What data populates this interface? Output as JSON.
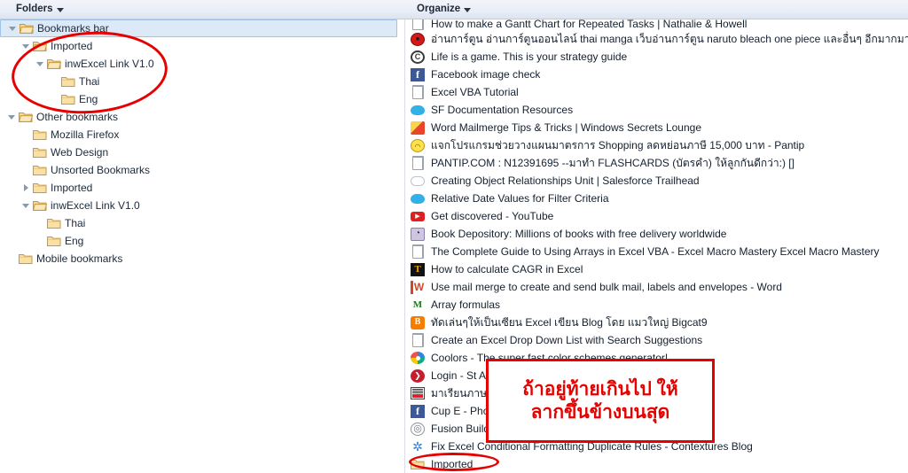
{
  "toolbar": {
    "folders_label": "Folders",
    "organize_label": "Organize"
  },
  "tree": {
    "items": [
      {
        "label": "Bookmarks bar",
        "depth": 0,
        "twisty": "open",
        "icon": "folder-open",
        "selected": true
      },
      {
        "label": "Imported",
        "depth": 1,
        "twisty": "open",
        "icon": "folder-open",
        "selected": false
      },
      {
        "label": "inwExcel Link V1.0",
        "depth": 2,
        "twisty": "open",
        "icon": "folder-open",
        "selected": false
      },
      {
        "label": "Thai",
        "depth": 3,
        "twisty": "none",
        "icon": "folder",
        "selected": false
      },
      {
        "label": "Eng",
        "depth": 3,
        "twisty": "none",
        "icon": "folder",
        "selected": false
      },
      {
        "label": "Other bookmarks",
        "depth": 0,
        "twisty": "open",
        "icon": "folder-open",
        "selected": false
      },
      {
        "label": "Mozilla Firefox",
        "depth": 1,
        "twisty": "none",
        "icon": "folder",
        "selected": false
      },
      {
        "label": "Web Design",
        "depth": 1,
        "twisty": "none",
        "icon": "folder",
        "selected": false
      },
      {
        "label": "Unsorted Bookmarks",
        "depth": 1,
        "twisty": "none",
        "icon": "folder",
        "selected": false
      },
      {
        "label": "Imported",
        "depth": 1,
        "twisty": "closed",
        "icon": "folder",
        "selected": false
      },
      {
        "label": "inwExcel Link V1.0",
        "depth": 1,
        "twisty": "open",
        "icon": "folder-open",
        "selected": false
      },
      {
        "label": "Thai",
        "depth": 2,
        "twisty": "none",
        "icon": "folder",
        "selected": false
      },
      {
        "label": "Eng",
        "depth": 2,
        "twisty": "none",
        "icon": "folder",
        "selected": false
      },
      {
        "label": "Mobile bookmarks",
        "depth": 0,
        "twisty": "none",
        "icon": "folder",
        "selected": false
      }
    ]
  },
  "list": {
    "items": [
      {
        "label": "How to make a Gantt Chart for Repeated Tasks | Nathalie & Howell",
        "icon": "document-icon",
        "icon_class": "fv-doc",
        "clipped": true
      },
      {
        "label": "อ่านการ์ตูน อ่านการ์ตูนออนไลน์ thai manga เว็บอ่านการ์ตูน naruto bleach one piece และอื่นๆ อีกมากมาย",
        "icon": "sharingan-icon",
        "icon_class": "fv-sharingan"
      },
      {
        "label": "Life is a game. This is your strategy guide",
        "icon": "copyright-icon",
        "icon_class": "fv-copy",
        "glyph": "C"
      },
      {
        "label": "Facebook image check",
        "icon": "facebook-icon",
        "icon_class": "fv-fb",
        "glyph": "f"
      },
      {
        "label": "Excel VBA Tutorial",
        "icon": "document-icon",
        "icon_class": "fv-doc"
      },
      {
        "label": "SF Documentation Resources",
        "icon": "salesforce-cloud-icon",
        "icon_class": "fv-cloud"
      },
      {
        "label": "Word Mailmerge Tips & Tricks | Windows Secrets Lounge",
        "icon": "windows-secrets-icon",
        "icon_class": "fv-wsl"
      },
      {
        "label": "แจกโปรแกรมช่วยวางแผนมาตรการ Shopping ลดหย่อนภาษี 15,000 บาท - Pantip",
        "icon": "pantip-icon",
        "icon_class": "fv-pantip"
      },
      {
        "label": "PANTIP.COM : N12391695 --มาทำ FLASHCARDS (บัตรคำ) ให้ลูกกันดีกว่า:) []",
        "icon": "document-icon",
        "icon_class": "fv-doc"
      },
      {
        "label": "Creating Object Relationships Unit | Salesforce Trailhead",
        "icon": "cloud-outline-icon",
        "icon_class": "fv-cloud-o"
      },
      {
        "label": "Relative Date Values for Filter Criteria",
        "icon": "salesforce-cloud-icon",
        "icon_class": "fv-cloud"
      },
      {
        "label": "Get discovered - YouTube",
        "icon": "youtube-icon",
        "icon_class": "fv-yt"
      },
      {
        "label": "Book Depository: Millions of books with free delivery worldwide",
        "icon": "book-depository-icon",
        "icon_class": "fv-book"
      },
      {
        "label": "The Complete Guide to Using Arrays in Excel VBA - Excel Macro Mastery Excel Macro Mastery",
        "icon": "document-icon",
        "icon_class": "fv-doc"
      },
      {
        "label": "How to calculate CAGR in Excel",
        "icon": "tutorial-t-icon",
        "icon_class": "fv-t",
        "glyph": "T"
      },
      {
        "label": "Use mail merge to create and send bulk mail, labels and envelopes - Word",
        "icon": "word-icon",
        "icon_class": "fv-word",
        "glyph": "W"
      },
      {
        "label": "Array formulas",
        "icon": "mrexcel-icon",
        "icon_class": "fv-mm",
        "glyph": "M"
      },
      {
        "label": "ทัดเล่นๆให้เป็นเซียน Excel เขียน Blog โดย แมวใหญ่ Bigcat9",
        "icon": "blogger-icon",
        "icon_class": "fv-blogger",
        "glyph": "B"
      },
      {
        "label": "Create an Excel Drop Down List with Search Suggestions",
        "icon": "document-icon",
        "icon_class": "fv-doc"
      },
      {
        "label": "Coolors - The super fast color schemes generator!",
        "icon": "coolors-icon",
        "icon_class": "fv-coolors"
      },
      {
        "label": "Login - St Andrews",
        "icon": "st-andrews-icon",
        "icon_class": "fv-st"
      },
      {
        "label": "มาเรียนภาษาญี่ปุ่นกันเถอะ | NHK WORLD เรดิโอแจแปน",
        "icon": "nhk-icon",
        "icon_class": "fv-nhk"
      },
      {
        "label": "Cup E - Photoshop",
        "icon": "facebook-icon",
        "icon_class": "fv-fb",
        "glyph": "f"
      },
      {
        "label": "Fusion Builder",
        "icon": "fusion-builder-icon",
        "icon_class": "fv-fusion"
      },
      {
        "label": "Fix Excel Conditional Formatting Duplicate Rules - Contextures Blog",
        "icon": "gear-icon",
        "icon_class": "fv-gear"
      },
      {
        "label": "Imported",
        "icon": "folder-icon",
        "icon_class": "fv-folder"
      }
    ]
  },
  "annotations": {
    "note_line1": "ถ้าอยู่ท้ายเกินไป ให้",
    "note_line2": "ลากขึ้นข้างบนสุด",
    "highlight_color": "#e60000"
  }
}
